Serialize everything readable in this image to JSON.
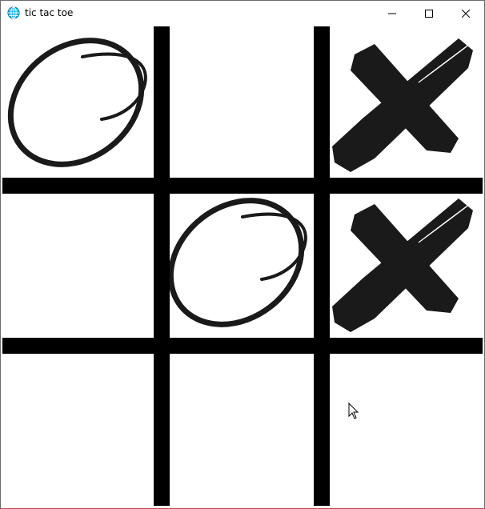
{
  "window": {
    "title": "tic tac toe",
    "icon": "globe-icon",
    "controls": [
      "minimize-icon",
      "maximize-icon",
      "close-icon"
    ]
  },
  "board": {
    "rows": [
      [
        "O",
        "",
        "X"
      ],
      [
        "",
        "O",
        "X"
      ],
      [
        "",
        "",
        ""
      ]
    ],
    "colors": {
      "line": "#000000",
      "mark": "#1a1a1a",
      "background": "#ffffff"
    }
  }
}
